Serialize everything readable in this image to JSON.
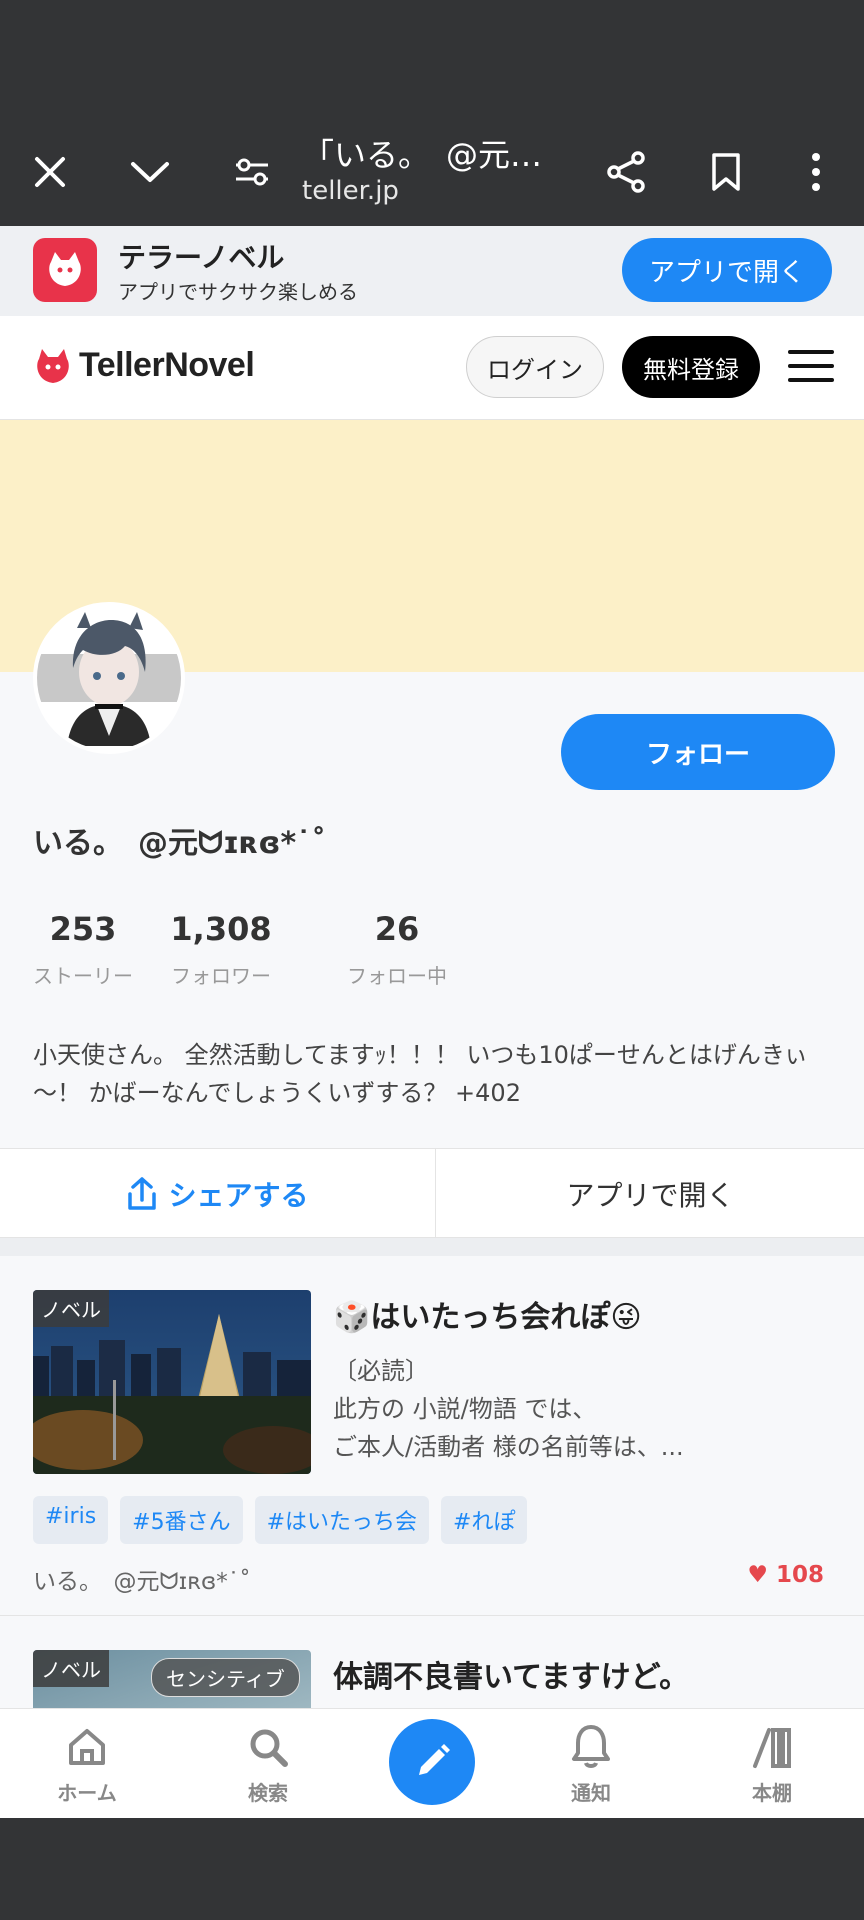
{
  "browser": {
    "page_title": "「いる。　@元…",
    "domain": "teller.jp"
  },
  "app_banner": {
    "name": "テラーノベル",
    "tagline": "アプリでサクサク楽しめる",
    "open_label": "アプリで開く"
  },
  "header": {
    "brand": "TellerNovel",
    "login_label": "ログイン",
    "signup_label": "無料登録"
  },
  "profile": {
    "follow_label": "フォロー",
    "display_name": "いる。　@元ᗢɪʀɞ*˙˚",
    "stats": [
      {
        "value": "253",
        "label": "ストーリー"
      },
      {
        "value": "1,308",
        "label": "フォロワー"
      },
      {
        "value": "26",
        "label": "フォロー中"
      }
    ],
    "bio": "小天使さん。 全然活動してますｯ！！！ いつも10ぱーせんとはげんきぃ～！ かばーなんでしょうくいずする？ +402",
    "share_label": "シェアする",
    "open_app_label": "アプリで開く"
  },
  "stories": [
    {
      "badge": "ノベル",
      "title": "🎲はいたっち会れぽ😜",
      "desc_line1": "〔必読〕",
      "desc_line2": "此方の 小説/物語 では、",
      "desc_line3": "ご本人/活動者 様の名前等は、...",
      "tags": [
        "#iris",
        "#5番さん",
        "#はいたっち会",
        "#れぽ"
      ],
      "author": "いる。　@元ᗢɪʀɞ*˙˚",
      "likes": "108"
    },
    {
      "badge": "ノベル",
      "sensitive": "センシティブ",
      "title": "体調不良書いてますけど。"
    }
  ],
  "bottom_nav": {
    "home": "ホーム",
    "search": "検索",
    "notifications": "通知",
    "bookshelf": "本棚"
  },
  "colors": {
    "accent": "#1e88f5",
    "brand_red": "#e8334a",
    "cover": "#fcf0c8",
    "like_red": "#e5484d"
  }
}
